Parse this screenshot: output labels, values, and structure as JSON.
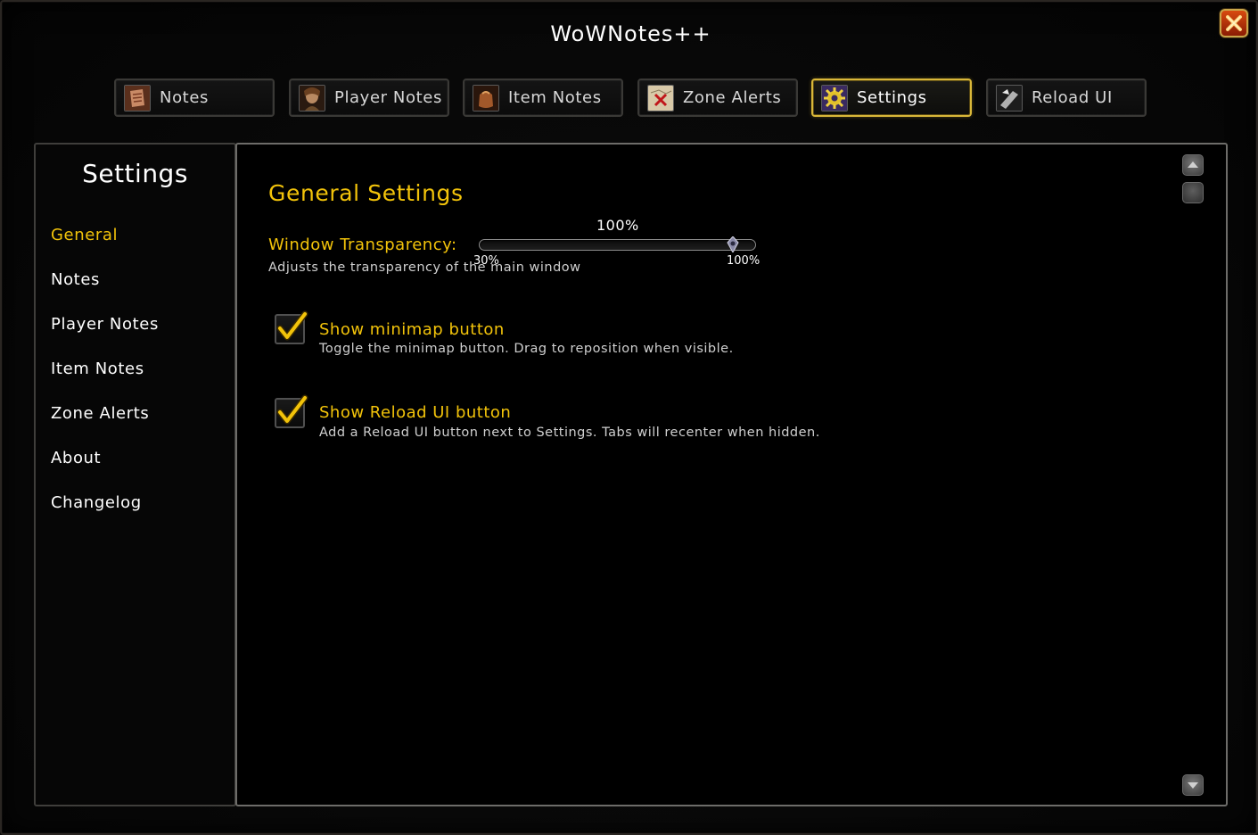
{
  "window": {
    "title": "WoWNotes++"
  },
  "tabs": [
    {
      "label": "Notes",
      "icon": "notes-scroll-icon",
      "active": false
    },
    {
      "label": "Player Notes",
      "icon": "player-portrait-icon",
      "active": false
    },
    {
      "label": "Item Notes",
      "icon": "item-bag-icon",
      "active": false
    },
    {
      "label": "Zone Alerts",
      "icon": "zone-map-icon",
      "active": false
    },
    {
      "label": "Settings",
      "icon": "settings-gear-icon",
      "active": true
    },
    {
      "label": "Reload UI",
      "icon": "reload-icon",
      "active": false
    }
  ],
  "sidebar": {
    "title": "Settings",
    "items": [
      {
        "label": "General",
        "active": true
      },
      {
        "label": "Notes",
        "active": false
      },
      {
        "label": "Player Notes",
        "active": false
      },
      {
        "label": "Item Notes",
        "active": false
      },
      {
        "label": "Zone Alerts",
        "active": false
      },
      {
        "label": "About",
        "active": false
      },
      {
        "label": "Changelog",
        "active": false
      }
    ]
  },
  "general": {
    "title": "General Settings",
    "transparency": {
      "label": "Window Transparency:",
      "description": "Adjusts the transparency of the main window",
      "value_text": "100%",
      "min_label": "30%",
      "max_label": "100%",
      "value": 100,
      "min": 30,
      "max": 100
    },
    "minimap": {
      "label": "Show minimap button",
      "description": "Toggle the minimap button. Drag to reposition when visible.",
      "checked": true
    },
    "reload": {
      "label": "Show Reload UI button",
      "description": "Add a Reload UI button next to Settings. Tabs will recenter when hidden.",
      "checked": true
    }
  },
  "colors": {
    "accent_gold": "#f2c30a",
    "active_tab_border": "#d9b739",
    "close_button": "#c4300a"
  }
}
